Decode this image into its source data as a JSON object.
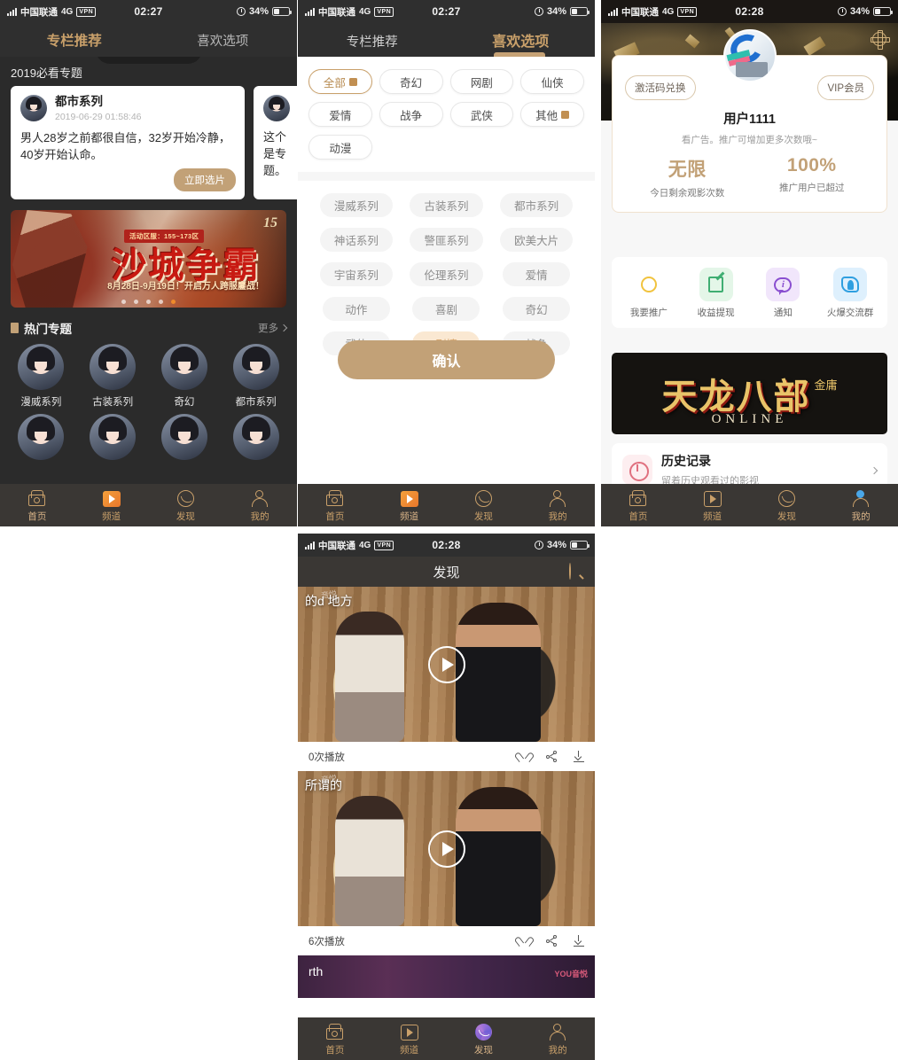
{
  "status_bar": {
    "carrier": "中国联通",
    "network": "4G",
    "vpn": "VPN",
    "time_227": "02:27",
    "time_228": "02:28",
    "battery": "34%"
  },
  "panel1": {
    "tabs": [
      {
        "label": "专栏推荐",
        "active": true
      },
      {
        "label": "喜欢选项",
        "active": false
      }
    ],
    "section_title": "2019必看专题",
    "cards": [
      {
        "name": "都市系列",
        "time": "2019-06-29 01:58:46",
        "text": "男人28岁之前都很自信，32岁开始冷静，40岁开始认命。",
        "button": "立即选片"
      },
      {
        "name": "",
        "time": "",
        "text": "这个是专题。",
        "button": ""
      }
    ],
    "banner": {
      "tag": "活动区服：155~173区",
      "title": "沙城争霸",
      "subtitle": "8月28日-9月19日！开启万人跨服鏖战！",
      "logo": "15"
    },
    "hot": {
      "title": "热门专题",
      "more": "更多"
    },
    "hot_items": [
      {
        "label": "漫威系列"
      },
      {
        "label": "古装系列"
      },
      {
        "label": "奇幻"
      },
      {
        "label": "都市系列"
      }
    ],
    "tabbar": [
      {
        "label": "首页",
        "icon": "home-icon",
        "active": true
      },
      {
        "label": "频道",
        "icon": "channel-icon",
        "active": false
      },
      {
        "label": "发现",
        "icon": "discover-icon",
        "active": false
      },
      {
        "label": "我的",
        "icon": "profile-icon",
        "active": false
      }
    ]
  },
  "panel2": {
    "tabs": [
      {
        "label": "专栏推荐",
        "active": false
      },
      {
        "label": "喜欢选项",
        "active": true
      }
    ],
    "primary_chips": [
      {
        "label": "全部",
        "selected": true,
        "swatch": true
      },
      {
        "label": "奇幻",
        "selected": false,
        "swatch": false
      },
      {
        "label": "网剧",
        "selected": false,
        "swatch": false
      },
      {
        "label": "仙侠",
        "selected": false,
        "swatch": false
      },
      {
        "label": "爱情",
        "selected": false,
        "swatch": false
      },
      {
        "label": "战争",
        "selected": false,
        "swatch": false
      },
      {
        "label": "武侠",
        "selected": false,
        "swatch": false
      },
      {
        "label": "其他",
        "selected": false,
        "swatch": true
      },
      {
        "label": "动漫",
        "selected": false,
        "swatch": false
      }
    ],
    "secondary_chips": [
      {
        "label": "漫威系列",
        "selected": false
      },
      {
        "label": "古装系列",
        "selected": false
      },
      {
        "label": "都市系列",
        "selected": false
      },
      {
        "label": "神话系列",
        "selected": false
      },
      {
        "label": "警匪系列",
        "selected": false
      },
      {
        "label": "欧美大片",
        "selected": false
      },
      {
        "label": "宇宙系列",
        "selected": false
      },
      {
        "label": "伦理系列",
        "selected": false
      },
      {
        "label": "爱情",
        "selected": false
      },
      {
        "label": "动作",
        "selected": false
      },
      {
        "label": "喜剧",
        "selected": false
      },
      {
        "label": "奇幻",
        "selected": false
      },
      {
        "label": "武侠",
        "selected": false
      },
      {
        "label": "剧情",
        "selected": true
      },
      {
        "label": "战争",
        "selected": false
      }
    ],
    "confirm_label": "确认",
    "tabbar": [
      {
        "label": "首页",
        "icon": "home-icon",
        "active": false
      },
      {
        "label": "频道",
        "icon": "channel-icon",
        "active": true
      },
      {
        "label": "发现",
        "icon": "discover-icon",
        "active": false
      },
      {
        "label": "我的",
        "icon": "profile-icon",
        "active": false
      }
    ]
  },
  "panel3": {
    "settings_icon": "gear-icon",
    "redeem_button": "激活码兑换",
    "vip_button": "VIP会员",
    "username": "用户1111",
    "hint": "看广告。推广可增加更多次数哦~",
    "stats": [
      {
        "value": "无限",
        "label": "今日剩余观影次数"
      },
      {
        "value": "100%",
        "label": "推广用户已超过"
      }
    ],
    "quick_icons": [
      {
        "label": "我要推广",
        "icon": "sun-icon"
      },
      {
        "label": "收益提现",
        "icon": "edit-note-icon"
      },
      {
        "label": "通知",
        "icon": "info-bubble-icon"
      },
      {
        "label": "火爆交流群",
        "icon": "rocket-icon"
      }
    ],
    "game_banner": {
      "title": "天龙八部",
      "suffix": "金庸",
      "sub": "ONLINE"
    },
    "history": {
      "title": "历史记录",
      "subtitle": "留着历史观看过的影视",
      "chevron": "chevron-right-icon"
    },
    "tabbar": [
      {
        "label": "首页",
        "icon": "home-icon",
        "active": false
      },
      {
        "label": "频道",
        "icon": "channel-icon",
        "active": false
      },
      {
        "label": "发现",
        "icon": "discover-icon",
        "active": false
      },
      {
        "label": "我的",
        "icon": "profile-icon",
        "active": true
      }
    ]
  },
  "panel4": {
    "title": "发现",
    "search_icon": "search-icon",
    "videos": [
      {
        "caption": "的d 地方",
        "watermark": "音悦",
        "plays": "0次播放"
      },
      {
        "caption": "所谓的",
        "watermark": "音悦",
        "plays": "6次播放"
      }
    ],
    "third_video": {
      "caption": "rth",
      "mark": "YOU音悦"
    },
    "actions": [
      {
        "name": "like",
        "icon": "heart-icon"
      },
      {
        "name": "share",
        "icon": "share-icon"
      },
      {
        "name": "download",
        "icon": "download-icon"
      }
    ],
    "tabbar": [
      {
        "label": "首页",
        "icon": "home-icon",
        "active": false
      },
      {
        "label": "频道",
        "icon": "channel-icon",
        "active": false
      },
      {
        "label": "发现",
        "icon": "discover-icon",
        "active": true
      },
      {
        "label": "我的",
        "icon": "profile-icon",
        "active": false
      }
    ]
  }
}
